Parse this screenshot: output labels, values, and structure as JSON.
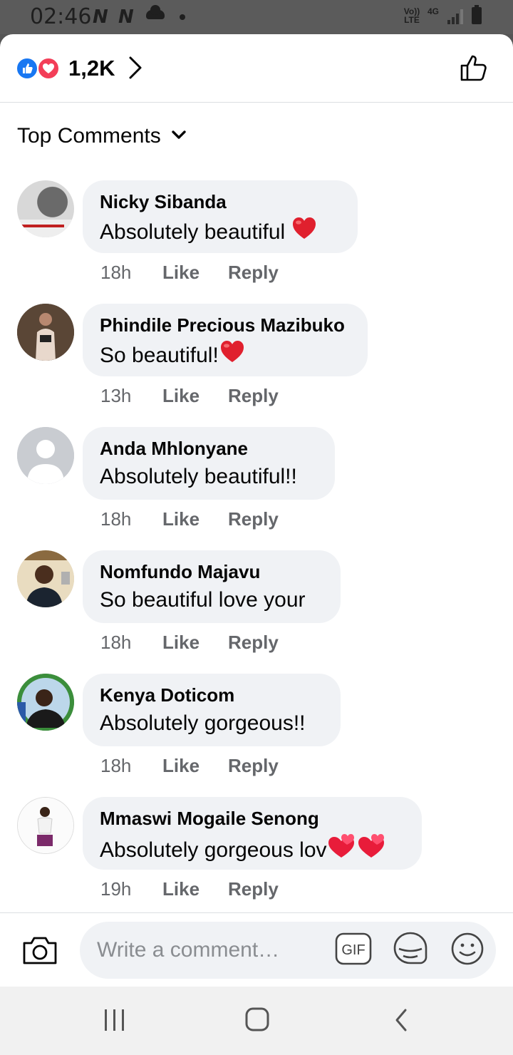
{
  "status_bar": {
    "time": "02:46",
    "notif_1": "N",
    "notif_2": "N",
    "volte": "Vo)) LTE",
    "network": "4G"
  },
  "reactions": {
    "count": "1,2K"
  },
  "sort": {
    "label": "Top Comments"
  },
  "comments": [
    {
      "name": "Nicky Sibanda",
      "text": "Absolutely beautiful",
      "emoji": "heart",
      "time": "18h",
      "like": "Like",
      "reply": "Reply"
    },
    {
      "name": "Phindile Precious Mazibuko",
      "text": "So beautiful!",
      "emoji": "heart",
      "time": "13h",
      "like": "Like",
      "reply": "Reply"
    },
    {
      "name": "Anda Mhlonyane",
      "text": "Absolutely beautiful!!",
      "emoji": "",
      "time": "18h",
      "like": "Like",
      "reply": "Reply"
    },
    {
      "name": "Nomfundo Majavu",
      "text": "So beautiful love your",
      "emoji": "",
      "time": "18h",
      "like": "Like",
      "reply": "Reply"
    },
    {
      "name": "Kenya Doticom",
      "text": "Absolutely gorgeous!!",
      "emoji": "",
      "time": "18h",
      "like": "Like",
      "reply": "Reply"
    },
    {
      "name": "Mmaswi Mogaile Senong",
      "text": "Absolutely gorgeous lov",
      "emoji": "two-hearts",
      "time": "19h",
      "like": "Like",
      "reply": "Reply"
    }
  ],
  "composer": {
    "placeholder": "Write a comment…"
  },
  "colors": {
    "facebook_blue": "#1877f2",
    "love_red": "#f33e58",
    "bubble_bg": "#f0f2f5",
    "meta_gray": "#65676b"
  }
}
